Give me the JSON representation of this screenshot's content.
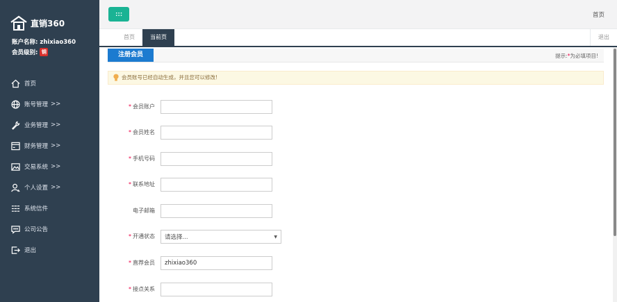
{
  "brand": {
    "name": "直销360",
    "logo_icon": "house-logo-icon"
  },
  "account": {
    "name_label": "账户名称:",
    "name_value": "zhixiao360",
    "level_label": "会员级别:",
    "level_badge": "铜"
  },
  "nav": [
    {
      "label": "首页",
      "icon": "home-icon",
      "arrow": ""
    },
    {
      "label": "账号管理",
      "icon": "globe-icon",
      "arrow": ">>"
    },
    {
      "label": "业务管理",
      "icon": "wrench-icon",
      "arrow": ">>"
    },
    {
      "label": "财务管理",
      "icon": "window-icon",
      "arrow": ">>"
    },
    {
      "label": "交易系统",
      "icon": "image-icon",
      "arrow": ">>"
    },
    {
      "label": "个人设置",
      "icon": "user-icon",
      "arrow": ">>"
    },
    {
      "label": "系统信件",
      "icon": "list-icon",
      "arrow": ""
    },
    {
      "label": "公司公告",
      "icon": "chat-icon",
      "arrow": ""
    },
    {
      "label": "退出",
      "icon": "logout-icon",
      "arrow": ""
    }
  ],
  "topbar": {
    "home_link": "首页"
  },
  "tabs": {
    "home": "首页",
    "current": "当前页",
    "logout": "退出"
  },
  "section": {
    "title": "注册会员",
    "hint_prefix": "提示:",
    "hint_star": "*",
    "hint_suffix": "为必填项目!"
  },
  "tip": "会员账号已经自动生成，并且您可以修改!",
  "form": {
    "account": {
      "label": "会员账户",
      "required": "*",
      "value": ""
    },
    "name": {
      "label": "会员姓名",
      "required": "*",
      "value": ""
    },
    "phone": {
      "label": "手机号码",
      "required": "*",
      "value": ""
    },
    "address": {
      "label": "联系地址",
      "required": "*",
      "value": ""
    },
    "email": {
      "label": "电子邮箱",
      "required": "",
      "value": ""
    },
    "status": {
      "label": "开通状态",
      "required": "*",
      "value": "请选择..."
    },
    "sponsor": {
      "label": "直荐会员",
      "required": "*",
      "value": "zhixiao360"
    },
    "relation": {
      "label": "接点关系",
      "required": "*",
      "value": ""
    }
  },
  "colors": {
    "sidebar": "#2f4050",
    "accent": "#1ab394",
    "section_blue": "#1c7bd0",
    "required": "#e04"
  }
}
